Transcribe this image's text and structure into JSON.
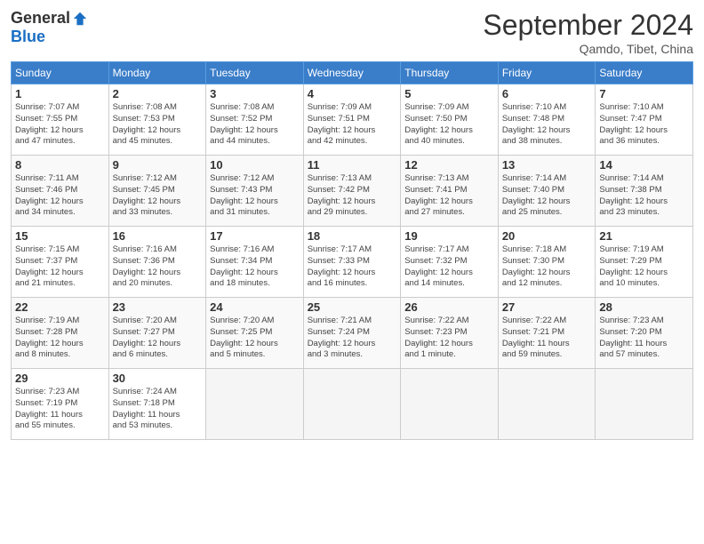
{
  "logo": {
    "general": "General",
    "blue": "Blue"
  },
  "header": {
    "month": "September 2024",
    "location": "Qamdo, Tibet, China"
  },
  "weekdays": [
    "Sunday",
    "Monday",
    "Tuesday",
    "Wednesday",
    "Thursday",
    "Friday",
    "Saturday"
  ],
  "weeks": [
    [
      {
        "day": "1",
        "info": "Sunrise: 7:07 AM\nSunset: 7:55 PM\nDaylight: 12 hours\nand 47 minutes."
      },
      {
        "day": "2",
        "info": "Sunrise: 7:08 AM\nSunset: 7:53 PM\nDaylight: 12 hours\nand 45 minutes."
      },
      {
        "day": "3",
        "info": "Sunrise: 7:08 AM\nSunset: 7:52 PM\nDaylight: 12 hours\nand 44 minutes."
      },
      {
        "day": "4",
        "info": "Sunrise: 7:09 AM\nSunset: 7:51 PM\nDaylight: 12 hours\nand 42 minutes."
      },
      {
        "day": "5",
        "info": "Sunrise: 7:09 AM\nSunset: 7:50 PM\nDaylight: 12 hours\nand 40 minutes."
      },
      {
        "day": "6",
        "info": "Sunrise: 7:10 AM\nSunset: 7:48 PM\nDaylight: 12 hours\nand 38 minutes."
      },
      {
        "day": "7",
        "info": "Sunrise: 7:10 AM\nSunset: 7:47 PM\nDaylight: 12 hours\nand 36 minutes."
      }
    ],
    [
      {
        "day": "8",
        "info": "Sunrise: 7:11 AM\nSunset: 7:46 PM\nDaylight: 12 hours\nand 34 minutes."
      },
      {
        "day": "9",
        "info": "Sunrise: 7:12 AM\nSunset: 7:45 PM\nDaylight: 12 hours\nand 33 minutes."
      },
      {
        "day": "10",
        "info": "Sunrise: 7:12 AM\nSunset: 7:43 PM\nDaylight: 12 hours\nand 31 minutes."
      },
      {
        "day": "11",
        "info": "Sunrise: 7:13 AM\nSunset: 7:42 PM\nDaylight: 12 hours\nand 29 minutes."
      },
      {
        "day": "12",
        "info": "Sunrise: 7:13 AM\nSunset: 7:41 PM\nDaylight: 12 hours\nand 27 minutes."
      },
      {
        "day": "13",
        "info": "Sunrise: 7:14 AM\nSunset: 7:40 PM\nDaylight: 12 hours\nand 25 minutes."
      },
      {
        "day": "14",
        "info": "Sunrise: 7:14 AM\nSunset: 7:38 PM\nDaylight: 12 hours\nand 23 minutes."
      }
    ],
    [
      {
        "day": "15",
        "info": "Sunrise: 7:15 AM\nSunset: 7:37 PM\nDaylight: 12 hours\nand 21 minutes."
      },
      {
        "day": "16",
        "info": "Sunrise: 7:16 AM\nSunset: 7:36 PM\nDaylight: 12 hours\nand 20 minutes."
      },
      {
        "day": "17",
        "info": "Sunrise: 7:16 AM\nSunset: 7:34 PM\nDaylight: 12 hours\nand 18 minutes."
      },
      {
        "day": "18",
        "info": "Sunrise: 7:17 AM\nSunset: 7:33 PM\nDaylight: 12 hours\nand 16 minutes."
      },
      {
        "day": "19",
        "info": "Sunrise: 7:17 AM\nSunset: 7:32 PM\nDaylight: 12 hours\nand 14 minutes."
      },
      {
        "day": "20",
        "info": "Sunrise: 7:18 AM\nSunset: 7:30 PM\nDaylight: 12 hours\nand 12 minutes."
      },
      {
        "day": "21",
        "info": "Sunrise: 7:19 AM\nSunset: 7:29 PM\nDaylight: 12 hours\nand 10 minutes."
      }
    ],
    [
      {
        "day": "22",
        "info": "Sunrise: 7:19 AM\nSunset: 7:28 PM\nDaylight: 12 hours\nand 8 minutes."
      },
      {
        "day": "23",
        "info": "Sunrise: 7:20 AM\nSunset: 7:27 PM\nDaylight: 12 hours\nand 6 minutes."
      },
      {
        "day": "24",
        "info": "Sunrise: 7:20 AM\nSunset: 7:25 PM\nDaylight: 12 hours\nand 5 minutes."
      },
      {
        "day": "25",
        "info": "Sunrise: 7:21 AM\nSunset: 7:24 PM\nDaylight: 12 hours\nand 3 minutes."
      },
      {
        "day": "26",
        "info": "Sunrise: 7:22 AM\nSunset: 7:23 PM\nDaylight: 12 hours\nand 1 minute."
      },
      {
        "day": "27",
        "info": "Sunrise: 7:22 AM\nSunset: 7:21 PM\nDaylight: 11 hours\nand 59 minutes."
      },
      {
        "day": "28",
        "info": "Sunrise: 7:23 AM\nSunset: 7:20 PM\nDaylight: 11 hours\nand 57 minutes."
      }
    ],
    [
      {
        "day": "29",
        "info": "Sunrise: 7:23 AM\nSunset: 7:19 PM\nDaylight: 11 hours\nand 55 minutes."
      },
      {
        "day": "30",
        "info": "Sunrise: 7:24 AM\nSunset: 7:18 PM\nDaylight: 11 hours\nand 53 minutes."
      },
      {
        "day": "",
        "info": ""
      },
      {
        "day": "",
        "info": ""
      },
      {
        "day": "",
        "info": ""
      },
      {
        "day": "",
        "info": ""
      },
      {
        "day": "",
        "info": ""
      }
    ]
  ]
}
